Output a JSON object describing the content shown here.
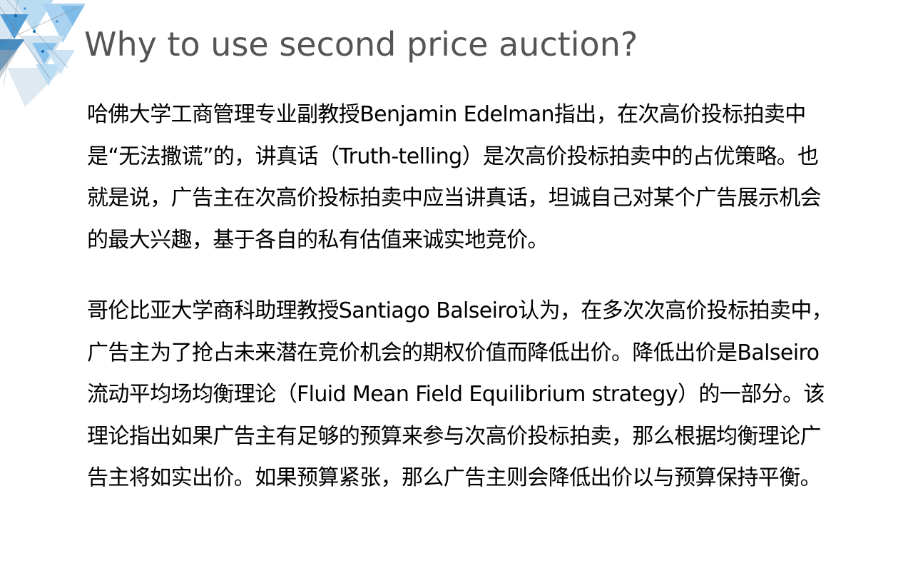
{
  "slide": {
    "title": "Why to use second price auction?",
    "paragraphs": [
      "哈佛大学工商管理专业副教授Benjamin Edelman指出，在次高价投标拍卖中是“无法撒谎”的，讲真话（Truth-telling）是次高价投标拍卖中的占优策略。也就是说，广告主在次高价投标拍卖中应当讲真话，坦诚自己对某个广告展示机会的最大兴趣，基于各自的私有估值来诚实地竞价。",
      "哥伦比亚大学商科助理教授Santiago Balseiro认为，在多次次高价投标拍卖中，广告主为了抢占未来潜在竞价机会的期权价值而降低出价。降低出价是Balseiro流动平均场均衡理论（Fluid Mean Field Equilibrium strategy）的一部分。该理论指出如果广告主有足够的预算来参与次高价投标拍卖，那么根据均衡理论广告主将如实出价。如果预算紧张，那么广告主则会降低出价以与预算保持平衡。"
    ]
  },
  "decoration": {
    "icon": "triangle-pattern-icon",
    "colors": [
      "#1b6fb0",
      "#3a8fd0",
      "#7fbde8",
      "#b9dcf3",
      "#d6e6f2",
      "#9aa7b3"
    ]
  }
}
